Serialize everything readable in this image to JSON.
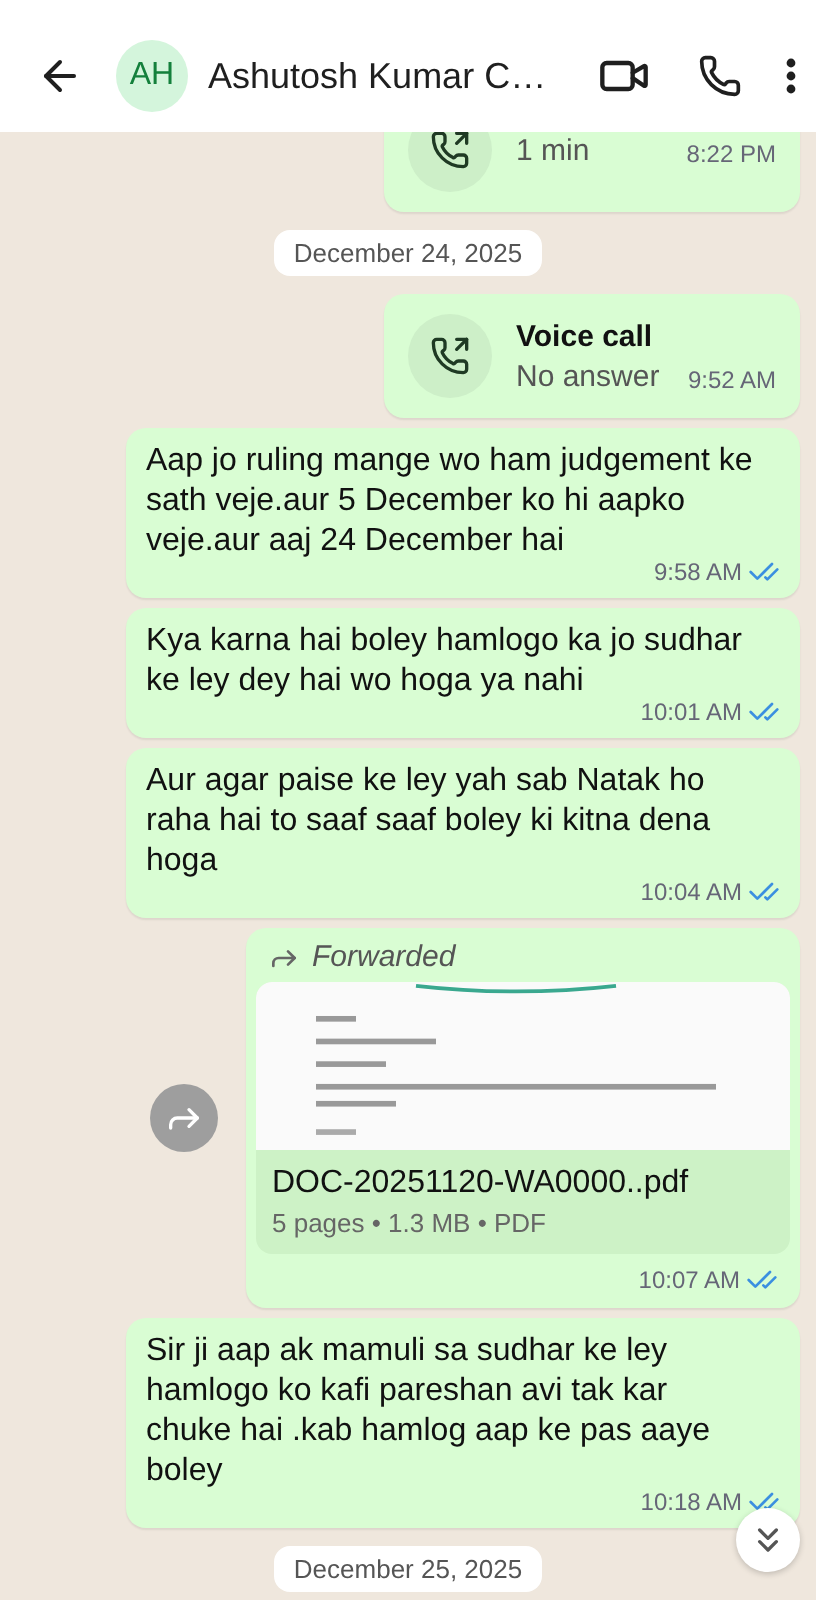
{
  "header": {
    "avatar_initials": "AH",
    "name": "Ashutosh Kumar C…"
  },
  "messages": [
    {
      "kind": "call",
      "detail": "1 min",
      "time": "8:22 PM"
    },
    {
      "kind": "date",
      "text": "December 24, 2025"
    },
    {
      "kind": "call",
      "title": "Voice call",
      "detail": "No answer",
      "time": "9:52 AM"
    },
    {
      "kind": "text",
      "text": "Aap jo ruling mange wo ham judgement ke sath veje.aur 5 December ko hi aapko veje.aur aaj 24 December hai",
      "time": "9:58 AM",
      "read": true
    },
    {
      "kind": "text",
      "text": "Kya karna hai boley hamlogo ka jo sudhar ke ley dey hai wo hoga ya nahi",
      "time": "10:01 AM",
      "read": true
    },
    {
      "kind": "text",
      "text": "Aur agar paise ke ley yah sab Natak ho raha hai to saaf saaf boley ki kitna dena hoga",
      "time": "10:04 AM",
      "read": true
    },
    {
      "kind": "document",
      "forwarded_label": "Forwarded",
      "file_name": "DOC-20251120-WA0000..pdf",
      "file_meta": "5 pages • 1.3 MB • PDF",
      "time": "10:07 AM",
      "read": true
    },
    {
      "kind": "text",
      "text": "Sir ji aap ak mamuli sa sudhar ke ley hamlogo ko kafi pareshan avi tak kar chuke hai .kab hamlog aap ke pas aaye boley",
      "time": "10:18 AM",
      "read": true
    },
    {
      "kind": "date",
      "text": "December 25, 2025"
    }
  ]
}
